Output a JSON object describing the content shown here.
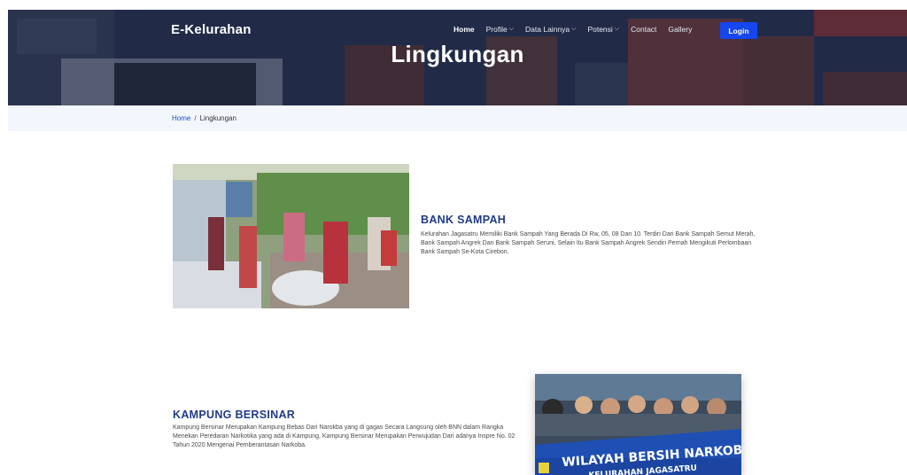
{
  "header": {
    "brand": "E-Kelurahan",
    "nav": [
      {
        "label": "Home",
        "active": true,
        "dropdown": false
      },
      {
        "label": "Profile",
        "active": false,
        "dropdown": true
      },
      {
        "label": "Data Lainnya",
        "active": false,
        "dropdown": true
      },
      {
        "label": "Potensi",
        "active": false,
        "dropdown": true
      },
      {
        "label": "Contact",
        "active": false,
        "dropdown": false
      },
      {
        "label": "Gallery",
        "active": false,
        "dropdown": false
      }
    ],
    "login_label": "Login",
    "page_title": "Lingkungan",
    "chevron_glyph": "⌵"
  },
  "breadcrumb": {
    "home": "Home",
    "separator": "/",
    "current": "Lingkungan"
  },
  "sections": [
    {
      "title": "BANK SAMPAH",
      "text": "Kelurahan Jagasatru Memiliki Bank Sampah Yang Berada Di Rw, 05, 08 Dan 10. Terdiri Dari Bank Sampah Semut Merah, Bank Sampah Angrek Dan Bank Sampah Seruni, Selain Itu Bank Sampah Angrek Sendiri Pernah Mengikuti Perlombaan Bank Sampah Se-Kota Cirebon."
    },
    {
      "title": "KAMPUNG BERSINAR",
      "text": "Kampung Bersinar Merupakan Kampung Bebas Dari Narokba yang di gagas Secara Langsung oleh BNN dalam Rangka Menekan Peredaran Narkotika yang ada di Kampung, Kampung Bersinar Merupakan Perwujudan Dari adanya Inspre No. 02 Tahun 2020 Mengenai Pemberantasan Narkoba.",
      "banner_text_line1": "WILAYAH BERSIH NARKOBA",
      "banner_text_line2": "KELURAHAN JAGASATRU"
    }
  ],
  "colors": {
    "accent": "#1646f0",
    "section_title": "#1f3c87",
    "breadcrumb_bg": "#f3f6fc",
    "link": "#1b4fd6"
  }
}
